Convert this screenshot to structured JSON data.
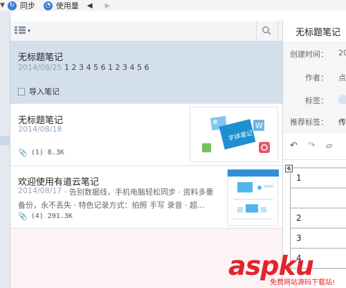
{
  "toolbar": {
    "sync_label": "同步",
    "usage_label": "使用量",
    "back_glyph": "◀",
    "forward_glyph": "▶"
  },
  "notes": [
    {
      "title": "无标题笔记",
      "date": "2014/08/25",
      "snippet": "1 2 3 4 5 6 1 2 3 4 5 6",
      "import_label": "导入笔记",
      "selected": true
    },
    {
      "title": "无标题笔记",
      "date": "2014/08/18",
      "attachment_count": "(1)",
      "size": "8.3K",
      "thumbnail_text": "字体笔记"
    },
    {
      "title": "欢迎使用有道云笔记",
      "date": "2014/08/17",
      "snippet_line1": "· 告别数据线，手机电脑轻松同步 · 资料多重",
      "snippet_line2": "备份，永不丢失 · 特色记录方式：拍照 手写 录音 · 超...",
      "attachment_count": "(4)",
      "size": "201.3K"
    }
  ],
  "editor": {
    "title": "无标题笔记",
    "created_label": "创建时间：",
    "created_value": "20",
    "author_label": "作者：",
    "author_value": "点",
    "tags_label": "标签：",
    "recommended_tags_label": "推荐标签：",
    "recommended_tags_value": "传"
  },
  "table_rows": [
    "1",
    "",
    "2",
    "3",
    "4"
  ],
  "icons": [
    "chevron-down-icon",
    "sync-icon",
    "usage-icon",
    "back-arrow-icon",
    "forward-arrow-icon",
    "list-view-icon",
    "search-icon",
    "paperclip-icon",
    "import-note-icon",
    "undo-icon",
    "redo-icon",
    "table-move-icon"
  ],
  "colors": {
    "selected_row": "#d3dfeb",
    "date_blue": "#8ea6c2",
    "watermark_red": "#e6232b",
    "accent_blue": "#3a7bd5"
  },
  "watermark": {
    "main": "aspku",
    "sub": "免费网站源码下载站!"
  }
}
